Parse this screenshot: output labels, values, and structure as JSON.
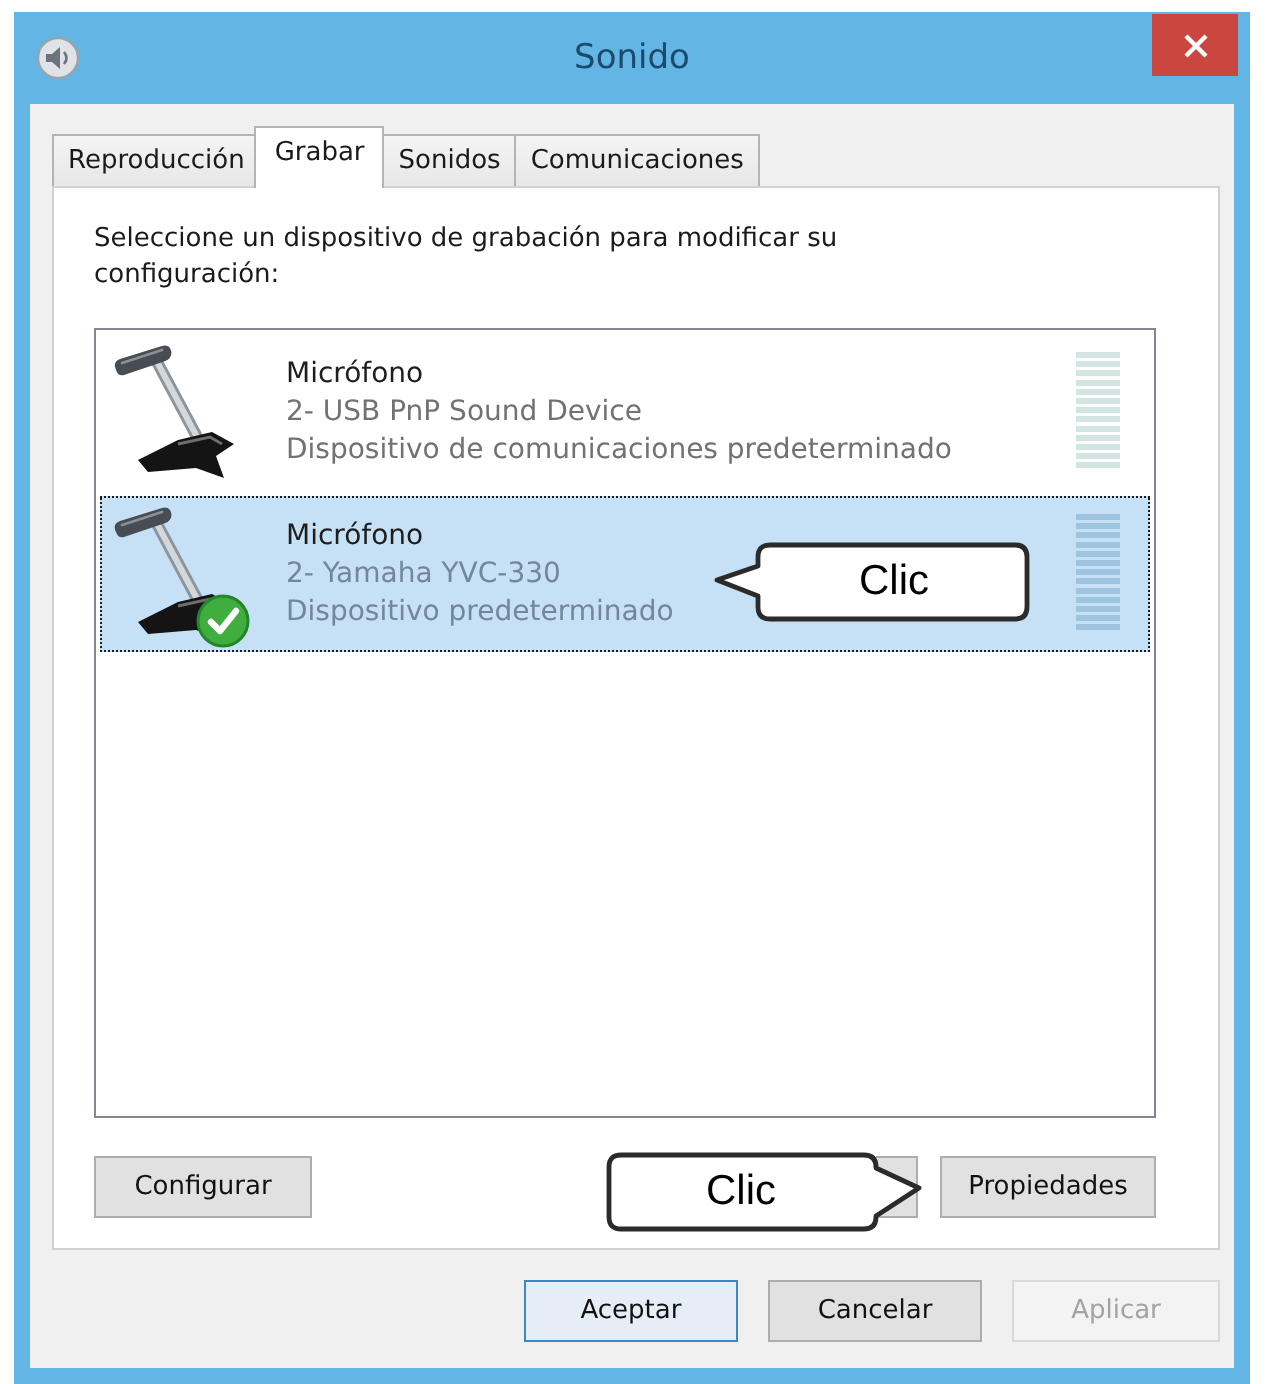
{
  "window": {
    "title": "Sonido"
  },
  "tabs": [
    {
      "label": "Reproducción",
      "selected": false
    },
    {
      "label": "Grabar",
      "selected": true
    },
    {
      "label": "Sonidos",
      "selected": false
    },
    {
      "label": "Comunicaciones",
      "selected": false
    }
  ],
  "instruction": "Seleccione un dispositivo de grabación para modificar su configuración:",
  "devices": [
    {
      "name": "Micrófono",
      "description": "2- USB PnP Sound Device",
      "status": "Dispositivo de comunicaciones predeterminado",
      "selected": false,
      "default": false
    },
    {
      "name": "Micrófono",
      "description": "2- Yamaha YVC-330",
      "status": "Dispositivo predeterminado",
      "selected": true,
      "default": true,
      "callout": "Clic"
    }
  ],
  "panel_buttons": [
    {
      "kind": "button",
      "label": "Configurar"
    },
    {
      "kind": "covered"
    },
    {
      "kind": "button",
      "label": "Propiedades",
      "callout": "Clic"
    }
  ],
  "dialog_buttons": [
    {
      "label": "Aceptar",
      "default": true,
      "disabled": false
    },
    {
      "label": "Cancelar",
      "default": false,
      "disabled": false
    },
    {
      "label": "Aplicar",
      "default": false,
      "disabled": true
    }
  ]
}
